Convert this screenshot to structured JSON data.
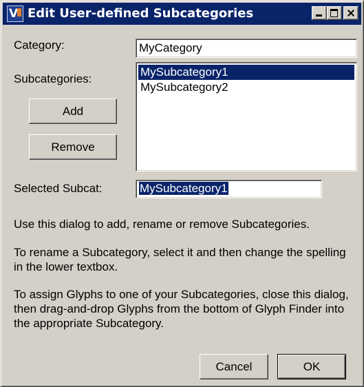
{
  "window": {
    "title": "Edit User-defined Subcategories"
  },
  "category": {
    "label": "Category:",
    "value": "MyCategory"
  },
  "subcategories": {
    "label": "Subcategories:",
    "items": [
      "MySubcategory1",
      "MySubcategory2"
    ],
    "selected_index": 0
  },
  "buttons": {
    "add": "Add",
    "remove": "Remove",
    "cancel": "Cancel",
    "ok": "OK"
  },
  "selected_subcat": {
    "label": "Selected Subcat:",
    "value": "MySubcategory1"
  },
  "help": {
    "p1": "Use this dialog to add, rename or remove Subcategories.",
    "p2": "To rename a Subcategory, select it and then change the spelling in the lower textbox.",
    "p3": "To assign Glyphs to one of your Subcategories, close this dialog, then drag-and-drop Glyphs from the bottom of Glyph Finder into the appropriate Subcategory."
  },
  "colors": {
    "face": "#d4d0c8",
    "titlebar": "#0a246a",
    "selection": "#0a246a"
  }
}
